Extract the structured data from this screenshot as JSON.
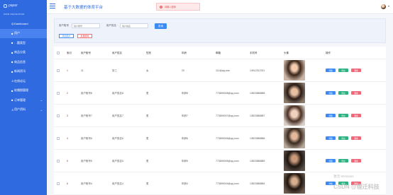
{
  "sidebar": {
    "logo_text": "paper",
    "section_title": "MAIN NAVIGATION",
    "items": [
      {
        "label": "Dashboard",
        "icon": "dashboard-icon",
        "glyph": "◎",
        "active": false,
        "has_arrow": false
      },
      {
        "label": "用户",
        "icon": "user-icon",
        "glyph": "■",
        "active": true,
        "has_arrow": false
      },
      {
        "label": "…题类型",
        "icon": "tag-icon",
        "glyph": "■",
        "active": false,
        "has_arrow": false
      },
      {
        "label": "商品分类",
        "icon": "category-icon",
        "glyph": "■",
        "active": false,
        "has_arrow": false
      },
      {
        "label": "商品信息",
        "icon": "product-icon",
        "glyph": "■",
        "active": false,
        "has_arrow": false
      },
      {
        "label": "新闻资讯",
        "icon": "news-icon",
        "glyph": "■",
        "active": false,
        "has_arrow": false
      },
      {
        "label": "在线论坛",
        "icon": "forum-icon",
        "glyph": "♙",
        "active": false,
        "has_arrow": false
      },
      {
        "label": "轮播图管理",
        "icon": "carousel-icon",
        "glyph": "■",
        "active": false,
        "has_arrow": false
      },
      {
        "label": "订单管理",
        "icon": "order-icon",
        "glyph": "■",
        "active": false,
        "has_arrow": true
      },
      {
        "label": "用户资料",
        "icon": "profile-icon",
        "glyph": "♙",
        "active": false,
        "has_arrow": true
      }
    ]
  },
  "topbar": {
    "title": "基于大数据的体育平台",
    "toast_text": "请输入密码",
    "colors": {
      "primary": "#2f6ae0",
      "toast_bg": "#fde9e9",
      "toast_text": "#e04848"
    }
  },
  "search": {
    "label1": "用户账号",
    "placeholder1": "用户账号",
    "label2": "用户姓名",
    "placeholder2": "用户姓名",
    "search_label": "查询",
    "add_label": "添加用户",
    "delete_label": "批量删除"
  },
  "table": {
    "columns": [
      "索引",
      "用户账号",
      "用户姓名",
      "性别",
      "年龄",
      "邮箱",
      "手机号",
      "头像",
      "操作"
    ],
    "actions": {
      "detail": "详情",
      "edit": "修改",
      "delete": "删除"
    },
    "rows": [
      {
        "index": "1",
        "account": "11",
        "name": "张三",
        "gender": "女",
        "age": "20",
        "email": "111@qq.com",
        "phone": "13912312311",
        "photo": "girl-long-hair"
      },
      {
        "index": "2",
        "account": "用户账号8",
        "name": "用户姓名8",
        "gender": "男",
        "age": "年龄8",
        "email": "773890008@qq.com",
        "phone": "13823888888",
        "photo": "girl-glasses"
      },
      {
        "index": "3",
        "account": "用户账号7",
        "name": "用户姓名7",
        "gender": "男",
        "age": "年龄7",
        "email": "773890007@qq.com",
        "phone": "13823888887",
        "photo": "girl-portrait"
      },
      {
        "index": "4",
        "account": "用户账号6",
        "name": "用户姓名6",
        "gender": "男",
        "age": "年龄6",
        "email": "773890006@qq.com",
        "phone": "13823888886",
        "photo": "man-portrait"
      },
      {
        "index": "5",
        "account": "用户账号5",
        "name": "用户姓名5",
        "gender": "男",
        "age": "年龄5",
        "email": "773890005@qq.com",
        "phone": "13823888885",
        "photo": "man-dark"
      },
      {
        "index": "6",
        "account": "用户账号4",
        "name": "用户姓名4",
        "gender": "男",
        "age": "年龄4",
        "email": "773890004@qq.com",
        "phone": "13823888884",
        "photo": "woman-dark"
      }
    ]
  },
  "watermark": {
    "line1": "激活 Windows",
    "line2": "CSDN @理迁科技"
  }
}
